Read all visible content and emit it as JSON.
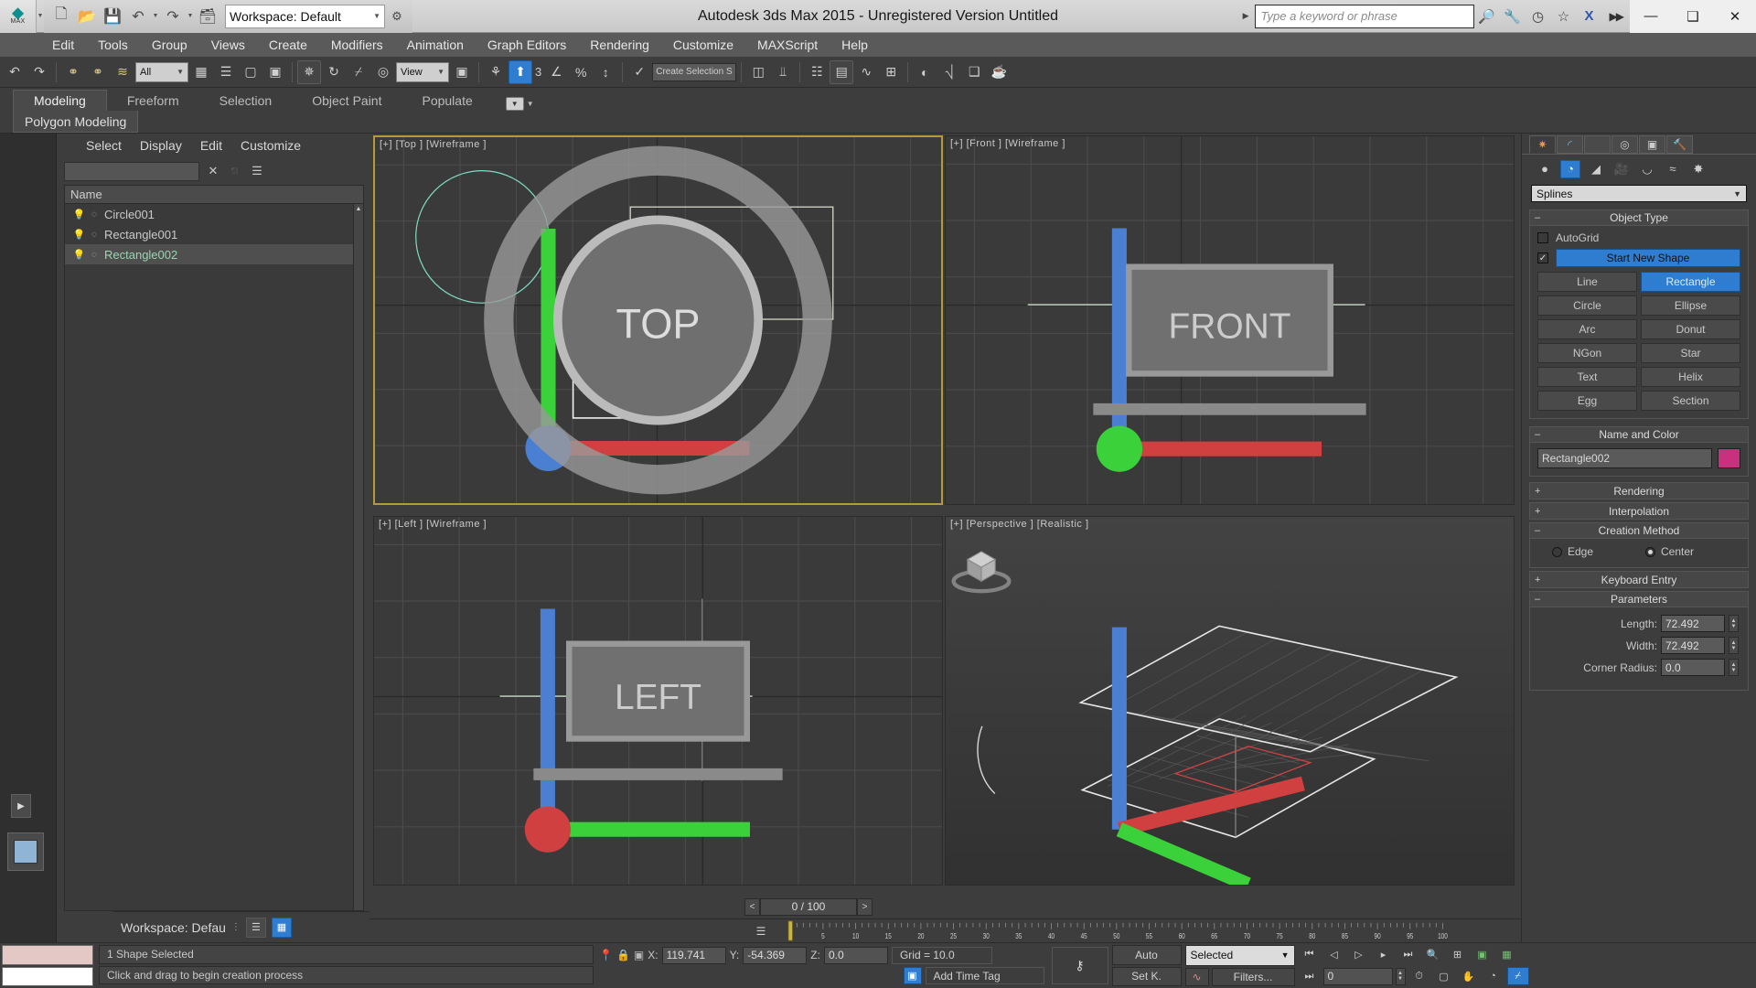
{
  "titlebar": {
    "logo_label": "MAX",
    "workspace_value": "Workspace: Default",
    "app_title": "Autodesk 3ds Max  2015  - Unregistered Version   Untitled",
    "search_placeholder": "Type a keyword or phrase",
    "quick_access": [
      {
        "name": "new-file-icon",
        "glyph": "❐"
      },
      {
        "name": "open-file-icon",
        "glyph": "📂"
      },
      {
        "name": "save-file-icon",
        "glyph": "💾"
      },
      {
        "name": "undo-icon",
        "glyph": "↶"
      },
      {
        "name": "redo-icon",
        "glyph": "↷"
      },
      {
        "name": "project-folder-icon",
        "glyph": "❐"
      }
    ],
    "right_icons": [
      {
        "name": "binoculars-icon",
        "glyph": "ଠଠ"
      },
      {
        "name": "wrench-icon",
        "glyph": "🔧"
      },
      {
        "name": "satellite-icon",
        "glyph": "◠"
      },
      {
        "name": "star-icon",
        "glyph": "☆"
      },
      {
        "name": "exchange-icon",
        "glyph": "X"
      }
    ],
    "window_buttons": [
      {
        "name": "minimize-button",
        "glyph": "—"
      },
      {
        "name": "restore-button",
        "glyph": "❐"
      },
      {
        "name": "close-button",
        "glyph": "✕"
      }
    ]
  },
  "menubar": {
    "items": [
      "Edit",
      "Tools",
      "Group",
      "Views",
      "Create",
      "Modifiers",
      "Animation",
      "Graph Editors",
      "Rendering",
      "Customize",
      "MAXScript",
      "Help"
    ]
  },
  "toolbar": {
    "selection_filter": "All",
    "reference_coord": "View",
    "named_selection_sets": "Create Selection S",
    "snap_label": "3",
    "icons": [
      {
        "name": "undo-icon",
        "glyph": "↶"
      },
      {
        "name": "redo-icon",
        "glyph": "↷"
      },
      {
        "name": "select-link-icon",
        "glyph": "⚭"
      },
      {
        "name": "unlink-selection-icon",
        "glyph": "⚭"
      },
      {
        "name": "bind-to-space-warp-icon",
        "glyph": "≋"
      },
      {
        "name": "select-object-icon",
        "glyph": "⬜"
      },
      {
        "name": "select-by-name-icon",
        "glyph": "☰"
      },
      {
        "name": "rectangular-region-icon",
        "glyph": "⬚"
      },
      {
        "name": "window-crossing-icon",
        "glyph": "⬚"
      },
      {
        "name": "select-and-move-icon",
        "glyph": "✥"
      },
      {
        "name": "select-and-rotate-icon",
        "glyph": "↻"
      },
      {
        "name": "select-and-scale-icon",
        "glyph": "⤡"
      },
      {
        "name": "select-and-place-icon",
        "glyph": "◔"
      },
      {
        "name": "use-center-flyout-icon",
        "glyph": "▣"
      },
      {
        "name": "select-and-manipulate-icon",
        "glyph": "⚒"
      },
      {
        "name": "snaps-toggle-icon",
        "glyph": "⬆"
      },
      {
        "name": "angle-snap-icon",
        "glyph": "∠"
      },
      {
        "name": "percent-snap-icon",
        "glyph": "%"
      },
      {
        "name": "spinner-snap-icon",
        "glyph": "↕"
      },
      {
        "name": "edit-named-selection-icon",
        "glyph": "{✓"
      },
      {
        "name": "mirror-icon",
        "glyph": "◧"
      },
      {
        "name": "align-icon",
        "glyph": "⫫"
      },
      {
        "name": "layer-manager-icon",
        "glyph": "≣"
      },
      {
        "name": "curve-editor-icon",
        "glyph": "∿"
      },
      {
        "name": "schematic-view-icon",
        "glyph": "⊞"
      },
      {
        "name": "material-editor-icon",
        "glyph": "◐"
      },
      {
        "name": "render-setup-icon",
        "glyph": "⌗"
      },
      {
        "name": "rendered-frame-icon",
        "glyph": "❑"
      },
      {
        "name": "render-production-icon",
        "glyph": "☕"
      }
    ]
  },
  "ribbon": {
    "tabs": [
      {
        "label": "Modeling",
        "active": true
      },
      {
        "label": "Freeform",
        "active": false
      },
      {
        "label": "Selection",
        "active": false
      },
      {
        "label": "Object Paint",
        "active": false
      },
      {
        "label": "Populate",
        "active": false
      }
    ],
    "panel_label": "Polygon Modeling"
  },
  "explorer": {
    "menu": [
      "Select",
      "Display",
      "Edit",
      "Customize"
    ],
    "search_value": "",
    "toolbar_icons": [
      {
        "name": "clear-search-icon",
        "glyph": "✕"
      },
      {
        "name": "select-children-icon",
        "glyph": "⬛"
      },
      {
        "name": "layer-list-icon",
        "glyph": "≡"
      }
    ],
    "column_header": "Name",
    "rows": [
      {
        "name": "Circle001",
        "selected": false
      },
      {
        "name": "Rectangle001",
        "selected": false
      },
      {
        "name": "Rectangle002",
        "selected": true
      }
    ],
    "footer_workspace": "Workspace: Defau",
    "footer_buttons": [
      {
        "name": "layer-explorer-button",
        "glyph": "≣",
        "active": false
      },
      {
        "name": "scene-explorer-button",
        "glyph": "▦",
        "active": true
      }
    ]
  },
  "viewports": [
    {
      "id": "top",
      "label": "[+] [Top ] [Wireframe ]",
      "active": true,
      "navcube": "TOP"
    },
    {
      "id": "front",
      "label": "[+] [Front ] [Wireframe ]",
      "active": false,
      "navcube": "FRONT"
    },
    {
      "id": "left",
      "label": "[+] [Left ] [Wireframe ]",
      "active": false,
      "navcube": "LEFT"
    },
    {
      "id": "perspective",
      "label": "[+] [Perspective ] [Realistic ]",
      "active": false,
      "navcube": ""
    }
  ],
  "timeline": {
    "current_frame_display": "0 / 100",
    "prev_glyph": "<",
    "next_glyph": ">",
    "range_start": 0,
    "range_end": 115,
    "tick_labels": [
      5,
      10,
      15,
      20,
      25,
      30,
      35,
      40,
      45,
      50,
      55,
      60,
      65,
      70,
      75,
      80,
      85,
      90,
      95,
      100
    ],
    "slider_position": 0
  },
  "command_panel": {
    "tabs": [
      {
        "name": "create-tab",
        "glyph": "✹",
        "active": true
      },
      {
        "name": "modify-tab",
        "glyph": "◜",
        "active": false
      },
      {
        "name": "hierarchy-tab",
        "glyph": "⑂",
        "active": false
      },
      {
        "name": "motion-tab",
        "glyph": "◎",
        "active": false
      },
      {
        "name": "display-tab",
        "glyph": "▣",
        "active": false
      },
      {
        "name": "utilities-tab",
        "glyph": "⚒",
        "active": false
      }
    ],
    "categories": [
      {
        "name": "geometry-category",
        "glyph": "●",
        "active": false
      },
      {
        "name": "shapes-category",
        "glyph": "◔",
        "active": true
      },
      {
        "name": "lights-category",
        "glyph": "◢",
        "active": false
      },
      {
        "name": "cameras-category",
        "glyph": "🎥",
        "active": false
      },
      {
        "name": "helpers-category",
        "glyph": "◱",
        "active": false
      },
      {
        "name": "space-warps-category",
        "glyph": "≈",
        "active": false
      },
      {
        "name": "systems-category",
        "glyph": "✸",
        "active": false
      }
    ],
    "category_dropdown": "Splines",
    "object_type": {
      "title": "Object Type",
      "autogrid_label": "AutoGrid",
      "autogrid_checked": false,
      "start_new_shape_label": "Start New Shape",
      "start_new_shape_checked": true,
      "buttons": [
        {
          "label": "Line",
          "active": false
        },
        {
          "label": "Rectangle",
          "active": true
        },
        {
          "label": "Circle",
          "active": false
        },
        {
          "label": "Ellipse",
          "active": false
        },
        {
          "label": "Arc",
          "active": false
        },
        {
          "label": "Donut",
          "active": false
        },
        {
          "label": "NGon",
          "active": false
        },
        {
          "label": "Star",
          "active": false
        },
        {
          "label": "Text",
          "active": false
        },
        {
          "label": "Helix",
          "active": false
        },
        {
          "label": "Egg",
          "active": false
        },
        {
          "label": "Section",
          "active": false
        }
      ]
    },
    "name_and_color": {
      "title": "Name and Color",
      "object_name": "Rectangle002",
      "color": "#c9317f"
    },
    "rendering_title": "Rendering",
    "interpolation_title": "Interpolation",
    "creation_method": {
      "title": "Creation Method",
      "options": [
        {
          "label": "Edge",
          "selected": false
        },
        {
          "label": "Center",
          "selected": true
        }
      ]
    },
    "keyboard_entry_title": "Keyboard Entry",
    "parameters": {
      "title": "Parameters",
      "fields": [
        {
          "label": "Length:",
          "value": "72.492"
        },
        {
          "label": "Width:",
          "value": "72.492"
        },
        {
          "label": "Corner Radius:",
          "value": "0.0"
        }
      ]
    }
  },
  "statusbar": {
    "selection_status": "1 Shape Selected",
    "prompt": "Click and drag to begin creation process",
    "coord_x_label": "X:",
    "coord_x": "119.741",
    "coord_y_label": "Y:",
    "coord_y": "-54.369",
    "coord_z_label": "Z:",
    "coord_z": "0.0",
    "grid_label": "Grid = 10.0",
    "add_time_tag": "Add Time Tag",
    "auto_key_label": "Auto",
    "set_key_label": "Set K.",
    "key_filter_value": "Selected",
    "filters_label": "Filters...",
    "current_frame": "0",
    "playback_icons": [
      {
        "name": "go-to-start-icon",
        "glyph": "⏮"
      },
      {
        "name": "previous-frame-icon",
        "glyph": "◁"
      },
      {
        "name": "play-animation-icon",
        "glyph": "▷"
      },
      {
        "name": "next-frame-icon",
        "glyph": "▷"
      },
      {
        "name": "go-to-end-icon",
        "glyph": "⏭"
      },
      {
        "name": "zoom-region-icon",
        "glyph": "🔍"
      },
      {
        "name": "zoom-extents-icon",
        "glyph": "⊞"
      },
      {
        "name": "zoom-all-icon",
        "glyph": "▣"
      },
      {
        "name": "maximize-viewport-icon",
        "glyph": "▦"
      }
    ],
    "bottom_icons": [
      {
        "name": "key-mode-icon",
        "glyph": "⏭"
      },
      {
        "name": "time-config-icon",
        "glyph": "⏱"
      },
      {
        "name": "zoom-region2-icon",
        "glyph": "⬚"
      },
      {
        "name": "pan-view-icon",
        "glyph": "✋"
      },
      {
        "name": "orbit-icon",
        "glyph": "◔"
      },
      {
        "name": "maximize-toggle-icon",
        "glyph": "⤡"
      }
    ]
  }
}
